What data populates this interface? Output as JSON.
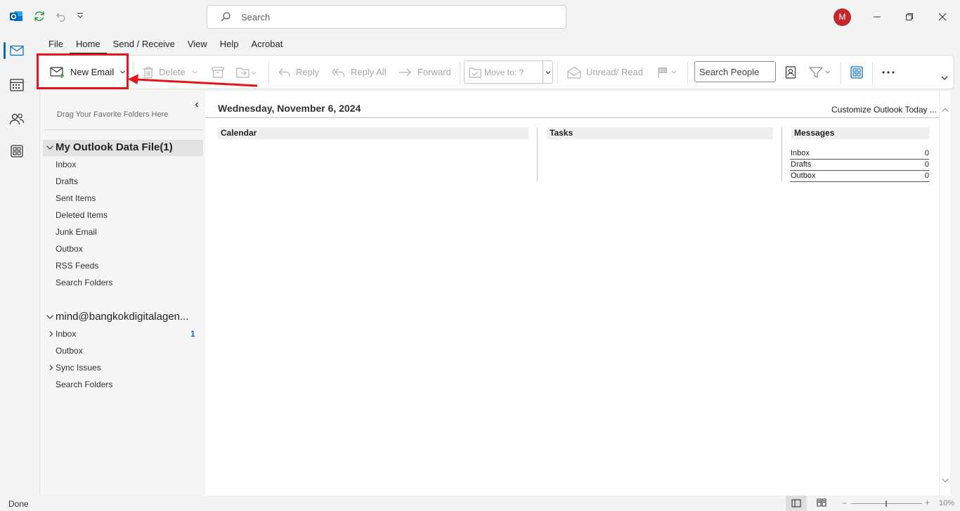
{
  "titlebar": {
    "search_placeholder": "Search",
    "avatar_initial": "M"
  },
  "menu": {
    "tabs": [
      "File",
      "Home",
      "Send / Receive",
      "View",
      "Help",
      "Acrobat"
    ],
    "active": "Home"
  },
  "ribbon": {
    "new_email": "New Email",
    "delete": "Delete",
    "reply": "Reply",
    "reply_all": "Reply All",
    "forward": "Forward",
    "move_to": "Move to: ?",
    "unread_read": "Unread/ Read",
    "search_people": "Search People"
  },
  "folders": {
    "fav_hint": "Drag Your Favorite Folders Here",
    "account1": {
      "name": "My Outlook Data File(1)",
      "items": [
        "Inbox",
        "Drafts",
        "Sent Items",
        "Deleted Items",
        "Junk Email",
        "Outbox",
        "RSS Feeds",
        "Search Folders"
      ]
    },
    "account2": {
      "name": "mind@bangkokdigitalagen...",
      "items": [
        {
          "label": "Inbox",
          "count": "1"
        },
        {
          "label": "Outbox",
          "count": ""
        },
        {
          "label": "Sync Issues",
          "count": ""
        },
        {
          "label": "Search Folders",
          "count": ""
        }
      ]
    }
  },
  "today": {
    "date": "Wednesday, November 6, 2024",
    "customize": "Customize Outlook Today ...",
    "calendar": "Calendar",
    "tasks": "Tasks",
    "messages": "Messages",
    "message_rows": [
      {
        "label": "Inbox",
        "count": "0"
      },
      {
        "label": "Drafts",
        "count": "0"
      },
      {
        "label": "Outbox",
        "count": "0"
      }
    ]
  },
  "status": {
    "text": "Done",
    "zoom": "10%"
  },
  "colors": {
    "accent": "#0f6cbd",
    "highlight": "#e8141b",
    "avatar": "#c4262e"
  }
}
